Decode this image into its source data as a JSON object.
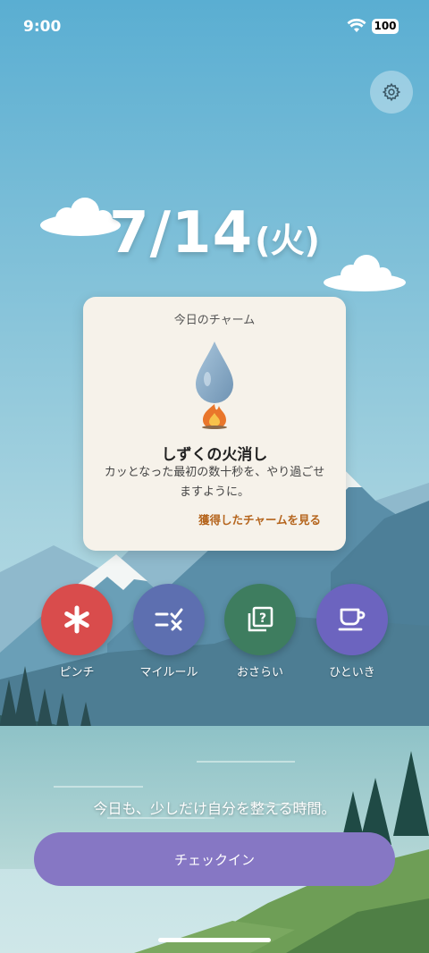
{
  "status_bar": {
    "time": "9:00",
    "battery": "100"
  },
  "date": {
    "month_day": "7/14",
    "weekday": "(火)"
  },
  "charm_card": {
    "label": "今日のチャーム",
    "name": "しずくの火消し",
    "description": "カッとなった最初の数十秒を、やり過ごせますように。",
    "link": "獲得したチャームを見る"
  },
  "actions": [
    {
      "label": "ピンチ",
      "color": "#d94c4c",
      "icon": "asterisk-icon"
    },
    {
      "label": "マイルール",
      "color": "#5d6fb0",
      "icon": "rules-icon"
    },
    {
      "label": "おさらい",
      "color": "#3e7d5f",
      "icon": "quiz-icon"
    },
    {
      "label": "ひといき",
      "color": "#6c64bf",
      "icon": "cup-icon"
    }
  ],
  "tagline": "今日も、少しだけ自分を整える時間。",
  "checkin_label": "チェックイン",
  "colors": {
    "sky_top": "#5fb0d3",
    "sky_bottom": "#cde6ea",
    "checkin": "#8677c4",
    "link": "#b5651d"
  }
}
